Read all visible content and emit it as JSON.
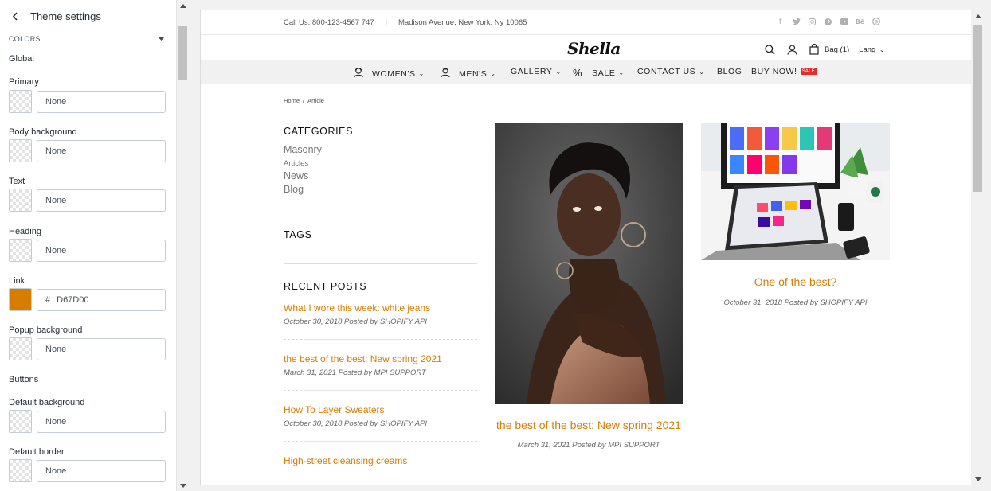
{
  "panel": {
    "title": "Theme settings",
    "section": "COLORS",
    "global_title": "Global",
    "colors": [
      {
        "label": "Primary",
        "value": "None"
      },
      {
        "label": "Body background",
        "value": "None"
      },
      {
        "label": "Text",
        "value": "None"
      },
      {
        "label": "Heading",
        "value": "None"
      },
      {
        "label": "Link",
        "value": "D67D00",
        "hash": "#",
        "swatch": "#d67d00"
      },
      {
        "label": "Popup background",
        "value": "None"
      }
    ],
    "buttons_title": "Buttons",
    "button_colors": [
      {
        "label": "Default background",
        "value": "None"
      },
      {
        "label": "Default border",
        "value": "None"
      }
    ]
  },
  "store": {
    "contact": "Call Us: 800-123-4567 747",
    "address": "Madison Avenue, New York, Ny 10065",
    "logo": "Shella",
    "bag": "Bag (1)",
    "lang": "Lang",
    "nav": [
      {
        "label": "WOMEN'S",
        "chev": true
      },
      {
        "label": "MEN'S",
        "chev": true
      },
      {
        "label": "GALLERY",
        "chev": true
      },
      {
        "label": "SALE",
        "chev": true
      },
      {
        "label": "CONTACT US",
        "chev": true
      },
      {
        "label": "BLOG",
        "chev": false
      },
      {
        "label": "BUY NOW!",
        "chev": false
      }
    ],
    "sale_badge": "SALE",
    "breadcrumb": {
      "home": "Home",
      "sep": "/",
      "current": "Article"
    },
    "categories_title": "CATEGORIES",
    "categories": [
      "Masonry",
      "Articles",
      "News",
      "Blog"
    ],
    "tags_title": "TAGS",
    "recent_title": "RECENT POSTS",
    "recent_posts": [
      {
        "title": "What I wore this week: white jeans",
        "meta": "October 30, 2018 Posted by SHOPIFY API"
      },
      {
        "title": "the best of the best: New spring 2021",
        "meta": "March 31, 2021 Posted by MPI SUPPORT"
      },
      {
        "title": "How To Layer Sweaters",
        "meta": "October 30, 2018 Posted by SHOPIFY API"
      },
      {
        "title": "High-street cleansing creams",
        "meta": ""
      }
    ],
    "articles": [
      {
        "title": "the best of the best: New spring 2021",
        "meta": "March 31, 2021 Posted by MPI SUPPORT"
      },
      {
        "title": "One of the best?",
        "meta": "October 31, 2018 Posted by SHOPIFY API"
      }
    ],
    "link_color": "#d67d00"
  }
}
